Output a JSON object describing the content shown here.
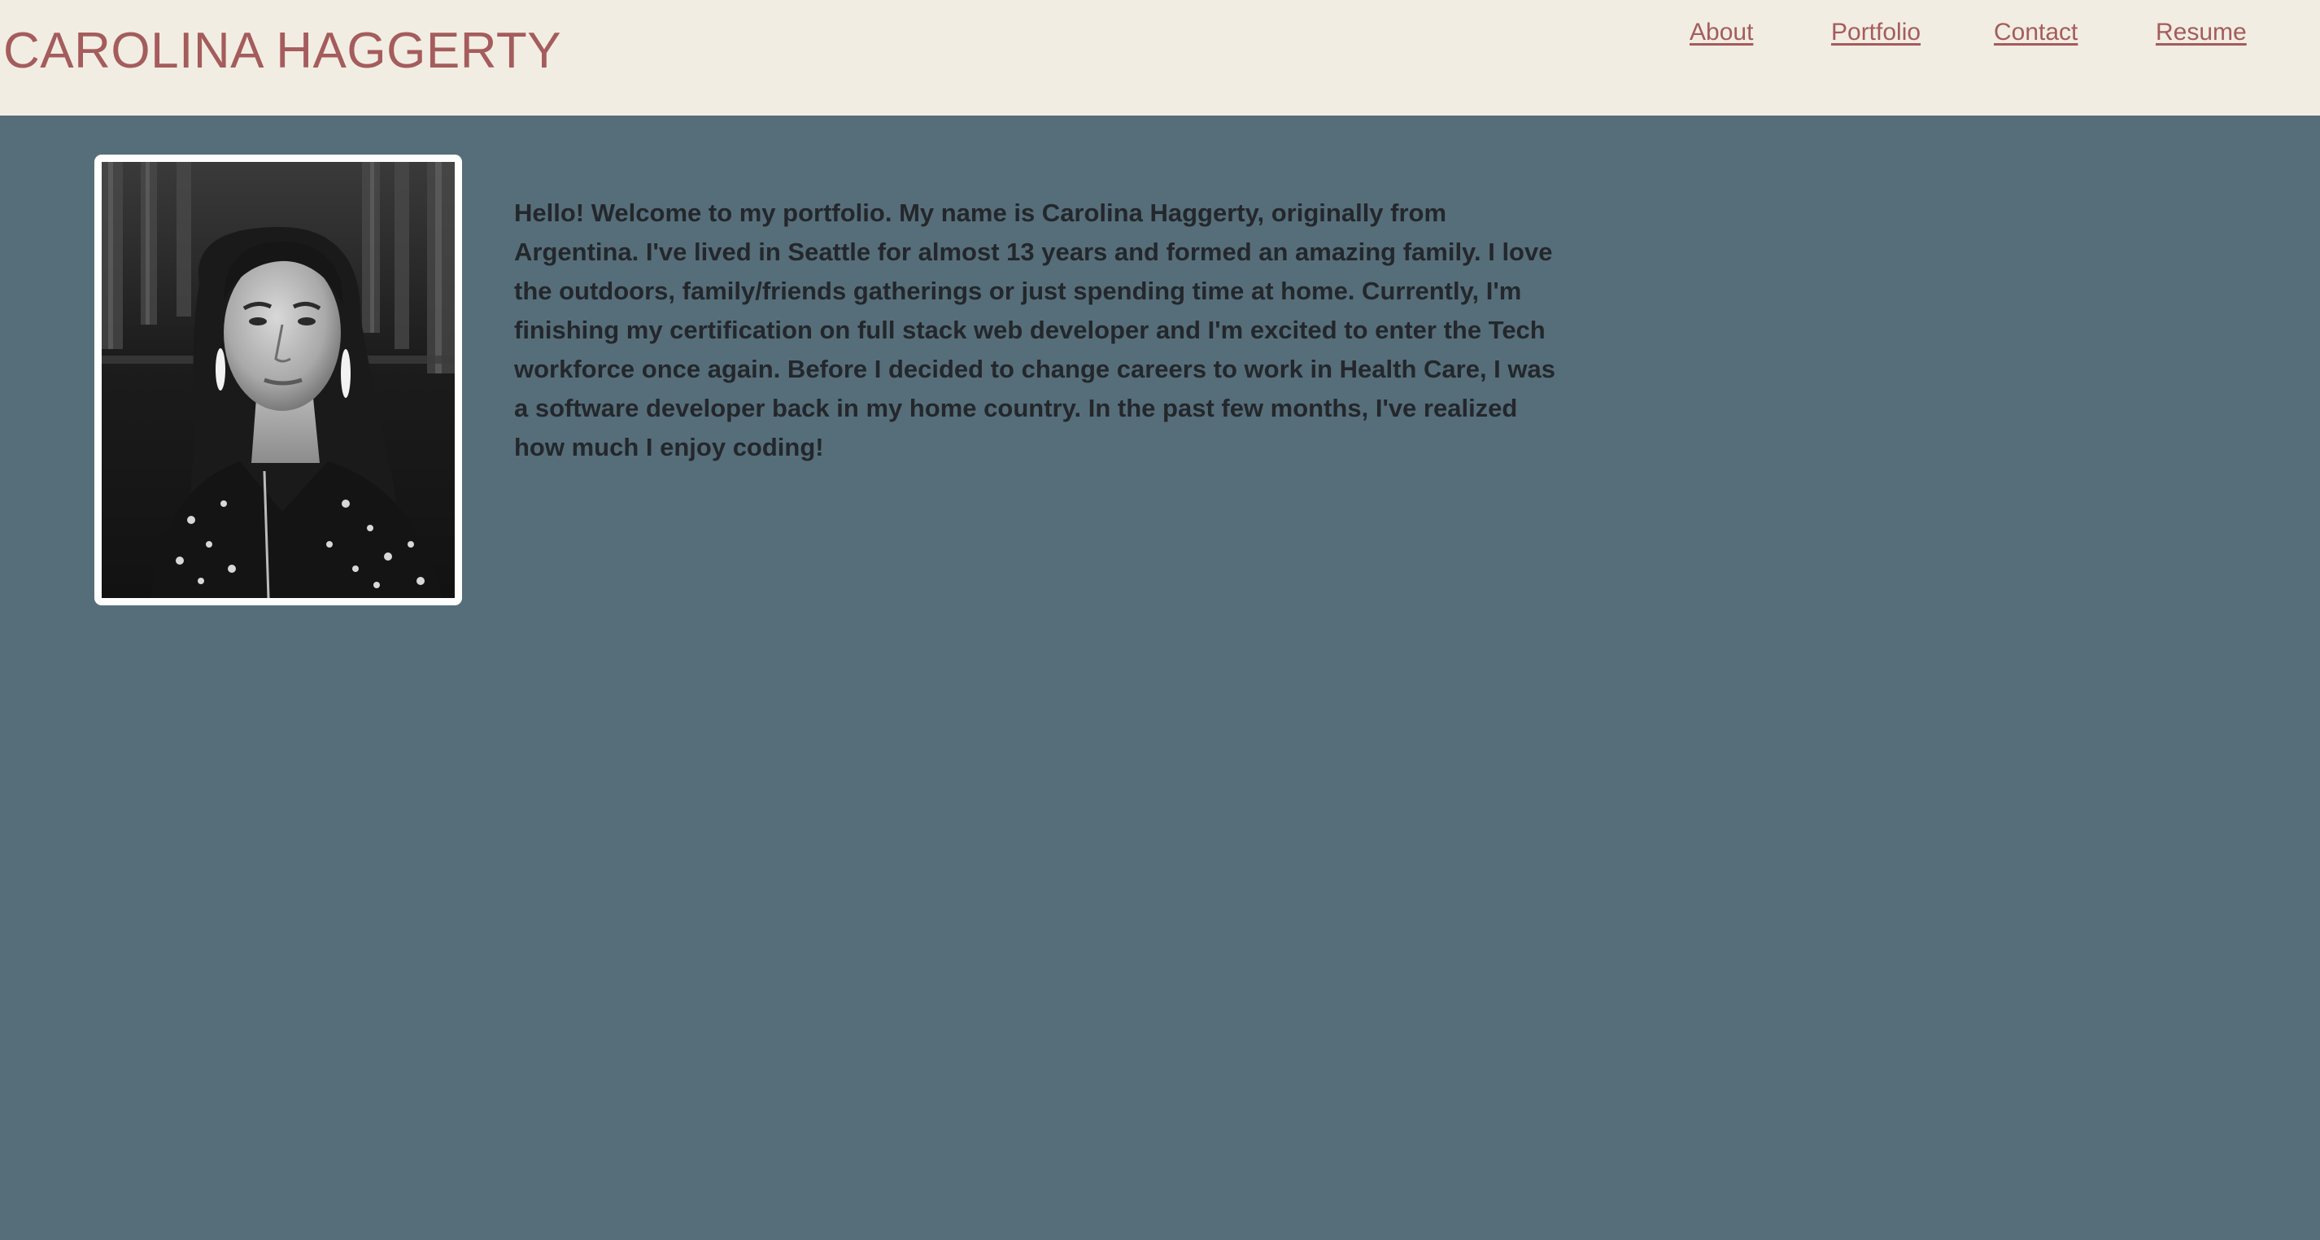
{
  "header": {
    "title": "CAROLINA HAGGERTY",
    "nav": [
      {
        "label": "About"
      },
      {
        "label": "Portfolio"
      },
      {
        "label": "Contact"
      },
      {
        "label": "Resume"
      }
    ]
  },
  "main": {
    "bio": "Hello! Welcome to my portfolio. My name is Carolina Haggerty, originally from Argentina. I've lived in Seattle for almost 13 years and formed an amazing family. I love the outdoors, family/friends gatherings or just spending time at home. Currently, I'm finishing my certification on full stack web developer and I'm excited to enter the Tech workforce once again. Before I decided to change careers to work in Health Care, I was a software developer back in my home country. In the past few months, I've realized how much I enjoy coding!"
  },
  "colors": {
    "background": "#566e7a",
    "header_background": "#f2ede2",
    "accent": "#a45c5c",
    "text": "#23272b"
  }
}
